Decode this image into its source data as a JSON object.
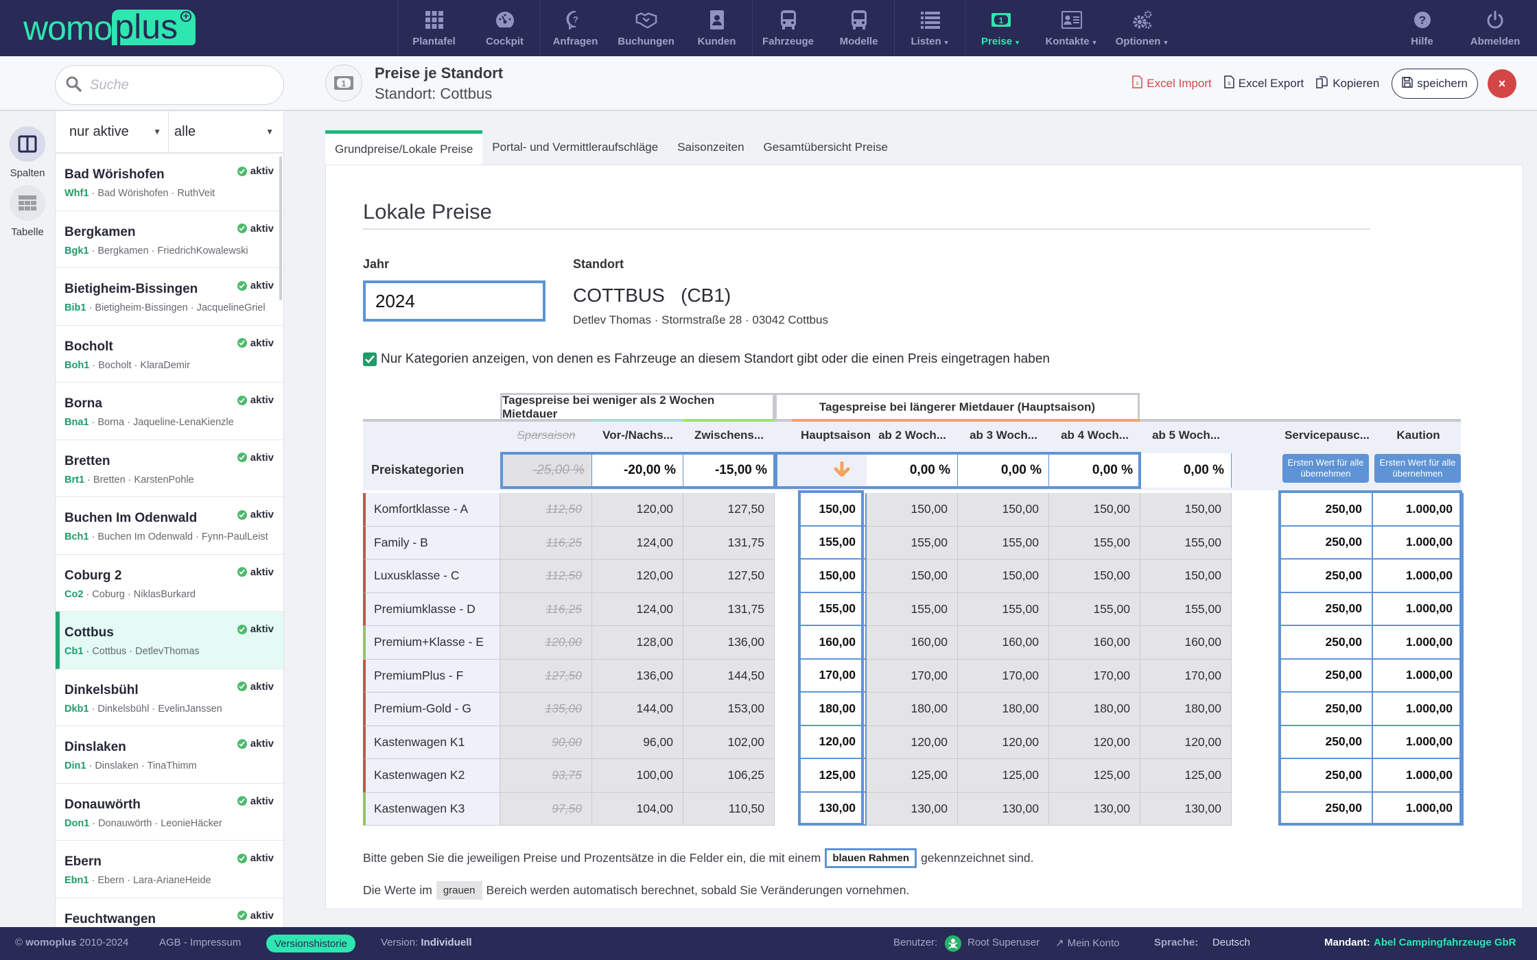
{
  "brand": {
    "logo_left": "womo",
    "logo_right": "plus"
  },
  "nav": {
    "items": [
      {
        "label": "Plantafel",
        "icon": "grid-icon"
      },
      {
        "label": "Cockpit",
        "icon": "dashboard-icon"
      },
      {
        "label": "Anfragen",
        "icon": "question-bubble-icon"
      },
      {
        "label": "Buchungen",
        "icon": "handshake-icon"
      },
      {
        "label": "Kunden",
        "icon": "address-book-icon"
      },
      {
        "label": "Fahrzeuge",
        "icon": "bus-icon"
      },
      {
        "label": "Modelle",
        "icon": "bus-icon"
      },
      {
        "label": "Listen",
        "icon": "list-icon",
        "dropdown": true
      },
      {
        "label": "Preise",
        "icon": "money-icon",
        "dropdown": true,
        "active": true
      },
      {
        "label": "Kontakte",
        "icon": "contact-card-icon",
        "dropdown": true
      },
      {
        "label": "Optionen",
        "icon": "gears-icon",
        "dropdown": true
      }
    ],
    "right": [
      {
        "label": "Hilfe",
        "icon": "help-icon"
      },
      {
        "label": "Abmelden",
        "icon": "power-icon"
      }
    ]
  },
  "search": {
    "placeholder": "Suche"
  },
  "page": {
    "title": "Preise je Standort",
    "subtitle": "Standort: Cottbus"
  },
  "actions": {
    "excel_import": "Excel Import",
    "excel_export": "Excel Export",
    "copy": "Kopieren",
    "save": "speichern",
    "close": "×"
  },
  "rail": {
    "columns": "Spalten",
    "table": "Tabelle"
  },
  "filters": {
    "status": "nur aktive",
    "type": "alle"
  },
  "locations": [
    {
      "name": "Bad Wörishofen",
      "code": "Whf1",
      "city": "Bad Wörishofen",
      "contact": "RuthVeit",
      "status": "aktiv"
    },
    {
      "name": "Bergkamen",
      "code": "Bgk1",
      "city": "Bergkamen",
      "contact": "FriedrichKowalewski",
      "status": "aktiv"
    },
    {
      "name": "Bietigheim-Bissingen",
      "code": "Bib1",
      "city": "Bietigheim-Bissingen",
      "contact": "JacquelineGriel",
      "status": "aktiv"
    },
    {
      "name": "Bocholt",
      "code": "Boh1",
      "city": "Bocholt",
      "contact": "KlaraDemir",
      "status": "aktiv"
    },
    {
      "name": "Borna",
      "code": "Bna1",
      "city": "Borna",
      "contact": "Jaqueline-LenaKienzle",
      "status": "aktiv"
    },
    {
      "name": "Bretten",
      "code": "Brt1",
      "city": "Bretten",
      "contact": "KarstenPohle",
      "status": "aktiv"
    },
    {
      "name": "Buchen Im Odenwald",
      "code": "Bch1",
      "city": "Buchen Im Odenwald",
      "contact": "Fynn-PaulLeist",
      "status": "aktiv"
    },
    {
      "name": "Coburg 2",
      "code": "Co2",
      "city": "Coburg",
      "contact": "NiklasBurkard",
      "status": "aktiv"
    },
    {
      "name": "Cottbus",
      "code": "Cb1",
      "city": "Cottbus",
      "contact": "DetlevThomas",
      "status": "aktiv",
      "selected": true
    },
    {
      "name": "Dinkelsbühl",
      "code": "Dkb1",
      "city": "Dinkelsbühl",
      "contact": "EvelinJanssen",
      "status": "aktiv"
    },
    {
      "name": "Dinslaken",
      "code": "Din1",
      "city": "Dinslaken",
      "contact": "TinaThimm",
      "status": "aktiv"
    },
    {
      "name": "Donauwörth",
      "code": "Don1",
      "city": "Donauwörth",
      "contact": "LeonieHäcker",
      "status": "aktiv"
    },
    {
      "name": "Ebern",
      "code": "Ebn1",
      "city": "Ebern",
      "contact": "Lara-ArianeHeide",
      "status": "aktiv"
    },
    {
      "name": "Feuchtwangen",
      "code": "",
      "city": "",
      "contact": "",
      "status": "aktiv"
    }
  ],
  "tabs": [
    "Grundpreise/Lokale Preise",
    "Portal- und Vermittleraufschläge",
    "Saisonzeiten",
    "Gesamtübersicht Preise"
  ],
  "section": {
    "title": "Lokale Preise",
    "year_label": "Jahr",
    "year_value": "2024",
    "location_label": "Standort",
    "location_name": "COTTBUS   (CB1)",
    "location_address": "Detlev Thomas · Stormstraße 28 · 03042 Cottbus",
    "checkbox_label": "Nur Kategorien anzeigen, von denen es Fahrzeuge an diesem Standort gibt oder die einen Preis eingetragen haben",
    "checkbox_checked": true
  },
  "table": {
    "group_short": "Tagespreise bei weniger als 2  Wochen Mietdauer",
    "group_long": "Tagespreise bei längerer Mietdauer (Hauptsaison)",
    "row_header": "Preiskategorien",
    "columns": [
      "Sparsaison",
      "Vor-/Nachs...",
      "Zwischens...",
      "Hauptsaison",
      "ab 2  Woch...",
      "ab 3  Woch...",
      "ab 4  Woch...",
      "ab 5  Woch...",
      "Servicepausc...",
      "Kaution"
    ],
    "percents": [
      "-25,00 %",
      "-20,00 %",
      "-15,00 %",
      "",
      "0,00 %",
      "0,00 %",
      "0,00 %",
      "0,00 %"
    ],
    "copy_button": "Ersten Wert für alle übernehmen",
    "season_colors": {
      "vor": "#a8dcd8",
      "zwischen": "#9ee65a",
      "haupt": "#f3a35a"
    },
    "rows": [
      {
        "cat": "Komfortklasse - A",
        "flag": "red",
        "v": [
          "112,50",
          "120,00",
          "127,50",
          "150,00",
          "150,00",
          "150,00",
          "150,00",
          "150,00",
          "250,00",
          "1.000,00"
        ]
      },
      {
        "cat": "Family - B",
        "flag": "red",
        "v": [
          "116,25",
          "124,00",
          "131,75",
          "155,00",
          "155,00",
          "155,00",
          "155,00",
          "155,00",
          "250,00",
          "1.000,00"
        ]
      },
      {
        "cat": "Luxusklasse - C",
        "flag": "red",
        "v": [
          "112,50",
          "120,00",
          "127,50",
          "150,00",
          "150,00",
          "150,00",
          "150,00",
          "150,00",
          "250,00",
          "1.000,00"
        ]
      },
      {
        "cat": "Premiumklasse - D",
        "flag": "red",
        "v": [
          "116,25",
          "124,00",
          "131,75",
          "155,00",
          "155,00",
          "155,00",
          "155,00",
          "155,00",
          "250,00",
          "1.000,00"
        ]
      },
      {
        "cat": "Premium+Klasse - E",
        "flag": "green",
        "v": [
          "120,00",
          "128,00",
          "136,00",
          "160,00",
          "160,00",
          "160,00",
          "160,00",
          "160,00",
          "250,00",
          "1.000,00"
        ]
      },
      {
        "cat": "PremiumPlus - F",
        "flag": "red",
        "v": [
          "127,50",
          "136,00",
          "144,50",
          "170,00",
          "170,00",
          "170,00",
          "170,00",
          "170,00",
          "250,00",
          "1.000,00"
        ]
      },
      {
        "cat": "Premium-Gold - G",
        "flag": "red",
        "v": [
          "135,00",
          "144,00",
          "153,00",
          "180,00",
          "180,00",
          "180,00",
          "180,00",
          "180,00",
          "250,00",
          "1.000,00"
        ]
      },
      {
        "cat": "Kastenwagen K1",
        "flag": "red",
        "v": [
          "90,00",
          "96,00",
          "102,00",
          "120,00",
          "120,00",
          "120,00",
          "120,00",
          "120,00",
          "250,00",
          "1.000,00"
        ]
      },
      {
        "cat": "Kastenwagen K2",
        "flag": "red",
        "v": [
          "93,75",
          "100,00",
          "106,25",
          "125,00",
          "125,00",
          "125,00",
          "125,00",
          "125,00",
          "250,00",
          "1.000,00"
        ]
      },
      {
        "cat": "Kastenwagen K3",
        "flag": "green",
        "v": [
          "97,50",
          "104,00",
          "110,50",
          "130,00",
          "130,00",
          "130,00",
          "130,00",
          "130,00",
          "250,00",
          "1.000,00"
        ]
      }
    ]
  },
  "hints": {
    "line1_pre": "Bitte geben Sie die jeweiligen Preise und Prozentsätze in die Felder ein, die mit einem",
    "line1_chip": "blauen Rahmen",
    "line1_post": "gekennzeichnet sind.",
    "line2_pre": "Die Werte im",
    "line2_chip": "grauen",
    "line2_post": "Bereich werden automatisch berechnet, sobald Sie Veränderungen vornehmen."
  },
  "footer": {
    "copyright_brand": "womoplus",
    "copyright_years": "2010-2024",
    "agb": "AGB - Impressum",
    "version_history": "Versionshistorie",
    "version_label": "Version:",
    "version_value": "Individuell",
    "user_label": "Benutzer:",
    "user_name": "Root Superuser",
    "account": "Mein Konto",
    "language_label": "Sprache:",
    "language_value": "Deutsch",
    "tenant_label": "Mandant:",
    "tenant_value": "Abel Campingfahrzeuge GbR"
  }
}
